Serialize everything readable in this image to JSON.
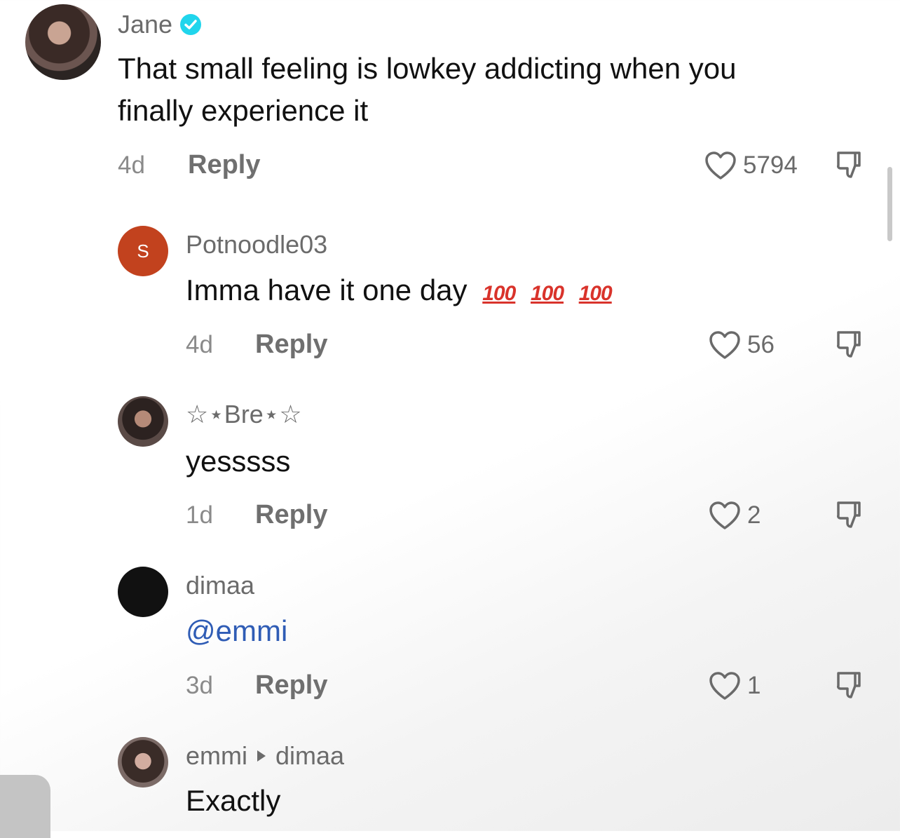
{
  "comments": [
    {
      "username": "Jane",
      "verified": true,
      "text_line1": "That small feeling is lowkey addicting when you",
      "text_line2": "finally experience it",
      "age": "4d",
      "reply_label": "Reply",
      "likes": "5794",
      "avatar": "photo"
    },
    {
      "username": "Potnoodle03",
      "avatar_letter": "S",
      "avatar_color": "#c2421e",
      "text": "Imma have it one day",
      "emoji": [
        "100",
        "100",
        "100"
      ],
      "age": "4d",
      "reply_label": "Reply",
      "likes": "56"
    },
    {
      "username": "☆⋆Bre⋆☆",
      "text": "yesssss",
      "age": "1d",
      "reply_label": "Reply",
      "likes": "2",
      "avatar": "photo"
    },
    {
      "username": "dimaa",
      "text": "@emmi",
      "age": "3d",
      "reply_label": "Reply",
      "likes": "1",
      "avatar_color": "#111111"
    },
    {
      "username": "emmi",
      "reply_to": "dimaa",
      "text": "Exactly",
      "avatar": "photo"
    }
  ],
  "colors": {
    "verified_badge": "#20d5ec",
    "mention": "#2f5cb5",
    "emoji_100": "#d9332b"
  },
  "icons": [
    "verified-badge-icon",
    "heart-outline-icon",
    "dislike-thumb-icon",
    "reply-arrow-icon"
  ]
}
